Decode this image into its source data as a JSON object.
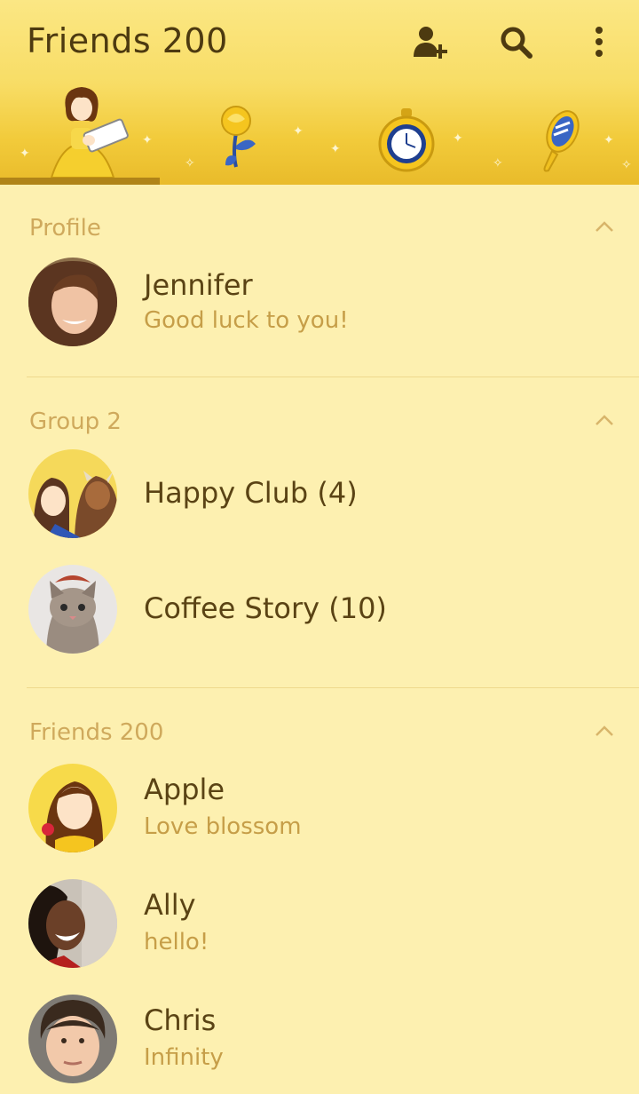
{
  "header": {
    "title": "Friends 200",
    "actions": [
      {
        "icon": "add-friend-icon"
      },
      {
        "icon": "search-icon"
      },
      {
        "icon": "more-vertical-icon"
      }
    ]
  },
  "tabs": [
    {
      "icon": "belle-reading-icon",
      "active": true
    },
    {
      "icon": "rose-icon",
      "active": false
    },
    {
      "icon": "pocket-watch-icon",
      "active": false
    },
    {
      "icon": "hand-mirror-icon",
      "active": false
    }
  ],
  "colors": {
    "background": "#fdf0b0",
    "header_top": "#fbe784",
    "header_bottom": "#e9bb2a",
    "tab_indicator": "#b08418",
    "name_text": "#5a4314",
    "status_text": "#c69e48",
    "section_text": "#cfa95c"
  },
  "sections": {
    "profile": {
      "title": "Profile",
      "items": [
        {
          "name": "Jennifer",
          "status": "Good luck to you!"
        }
      ]
    },
    "groups": {
      "title": "Group 2",
      "items": [
        {
          "name": "Happy Club (4)"
        },
        {
          "name": "Coffee Story (10)"
        }
      ]
    },
    "friends": {
      "title": "Friends 200",
      "items": [
        {
          "name": "Apple",
          "status": "Love blossom"
        },
        {
          "name": "Ally",
          "status": "hello!"
        },
        {
          "name": "Chris",
          "status": "Infinity"
        }
      ]
    }
  }
}
